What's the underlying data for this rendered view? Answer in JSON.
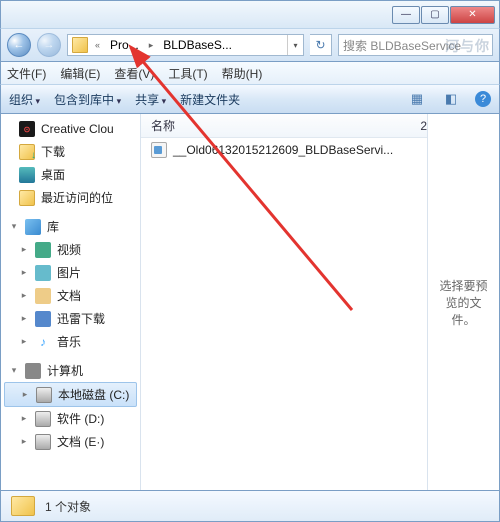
{
  "titlebar": {
    "min": "—",
    "max": "▢",
    "close": "✕"
  },
  "address": {
    "back": "←",
    "forward": "→",
    "sep1": "«",
    "crumb1": "Pro...",
    "sep2": "▸",
    "crumb2": "BLDBaseS...",
    "dropdown": "▾",
    "refresh": "↻"
  },
  "search": {
    "placeholder": "搜索 BLDBaseService",
    "watermark_overlay": "河与你"
  },
  "menu": {
    "file": "文件(F)",
    "edit": "编辑(E)",
    "view": "查看(V)",
    "tools": "工具(T)",
    "help": "帮助(H)"
  },
  "toolbar": {
    "organize": "组织",
    "include": "包含到库中",
    "share": "共享",
    "new_folder": "新建文件夹",
    "view_icon": "▦",
    "pane_icon": "◧",
    "help_icon": "?"
  },
  "sidebar": {
    "creative_cloud": "Creative Clou",
    "downloads": "下载",
    "desktop": "桌面",
    "recent": "最近访问的位",
    "libraries": "库",
    "videos": "视频",
    "pictures": "图片",
    "documents": "文档",
    "xunlei": "迅雷下载",
    "music": "音乐",
    "music_icon": "♪",
    "computer": "计算机",
    "drive_c": "本地磁盘 (C:)",
    "drive_d": "软件 (D:)",
    "drive_e_partial": "文档 (E·)"
  },
  "filelist": {
    "col_name": "名称",
    "col_right_hint": "2",
    "items": [
      {
        "name": "__Old06132015212609_BLDBaseServi..."
      }
    ]
  },
  "preview": {
    "text": "选择要预览的文件。"
  },
  "status": {
    "text": "1 个对象"
  }
}
